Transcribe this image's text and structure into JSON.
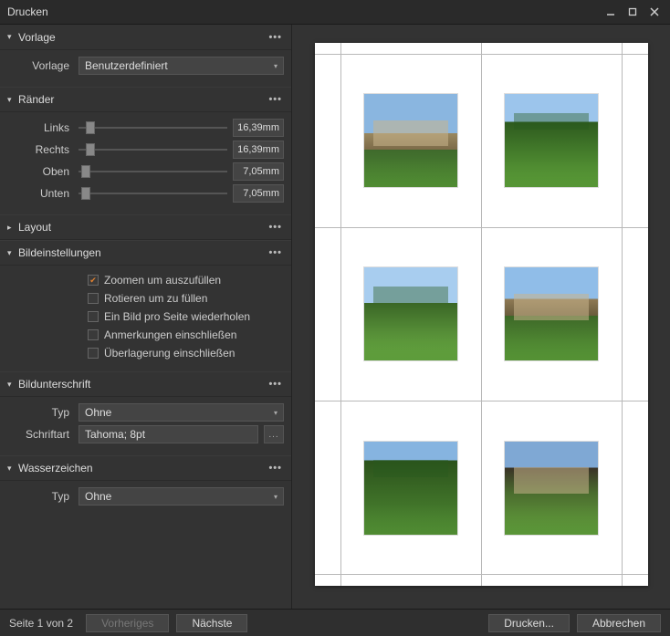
{
  "window": {
    "title": "Drucken"
  },
  "sections": {
    "vorlage": {
      "title": "Vorlage",
      "label": "Vorlage",
      "value": "Benutzerdefiniert"
    },
    "raender": {
      "title": "Ränder",
      "links": {
        "label": "Links",
        "value": "16,39mm"
      },
      "rechts": {
        "label": "Rechts",
        "value": "16,39mm"
      },
      "oben": {
        "label": "Oben",
        "value": "7,05mm"
      },
      "unten": {
        "label": "Unten",
        "value": "7,05mm"
      }
    },
    "layout": {
      "title": "Layout"
    },
    "bild": {
      "title": "Bildeinstellungen",
      "options": [
        {
          "label": "Zoomen um auszufüllen",
          "checked": true
        },
        {
          "label": "Rotieren um zu füllen",
          "checked": false
        },
        {
          "label": "Ein Bild pro Seite wiederholen",
          "checked": false
        },
        {
          "label": "Anmerkungen einschließen",
          "checked": false
        },
        {
          "label": "Überlagerung einschließen",
          "checked": false
        }
      ]
    },
    "caption": {
      "title": "Bildunterschrift",
      "typ_label": "Typ",
      "typ_value": "Ohne",
      "font_label": "Schriftart",
      "font_value": "Tahoma; 8pt"
    },
    "watermark": {
      "title": "Wasserzeichen",
      "typ_label": "Typ",
      "typ_value": "Ohne"
    }
  },
  "footer": {
    "page_text": "Seite 1 von 2",
    "prev": "Vorheriges",
    "next": "Nächste",
    "print": "Drucken...",
    "cancel": "Abbrechen"
  },
  "preview": {
    "page_count": 2,
    "current_page": 1,
    "grid": {
      "cols": 2,
      "rows": 3
    }
  }
}
